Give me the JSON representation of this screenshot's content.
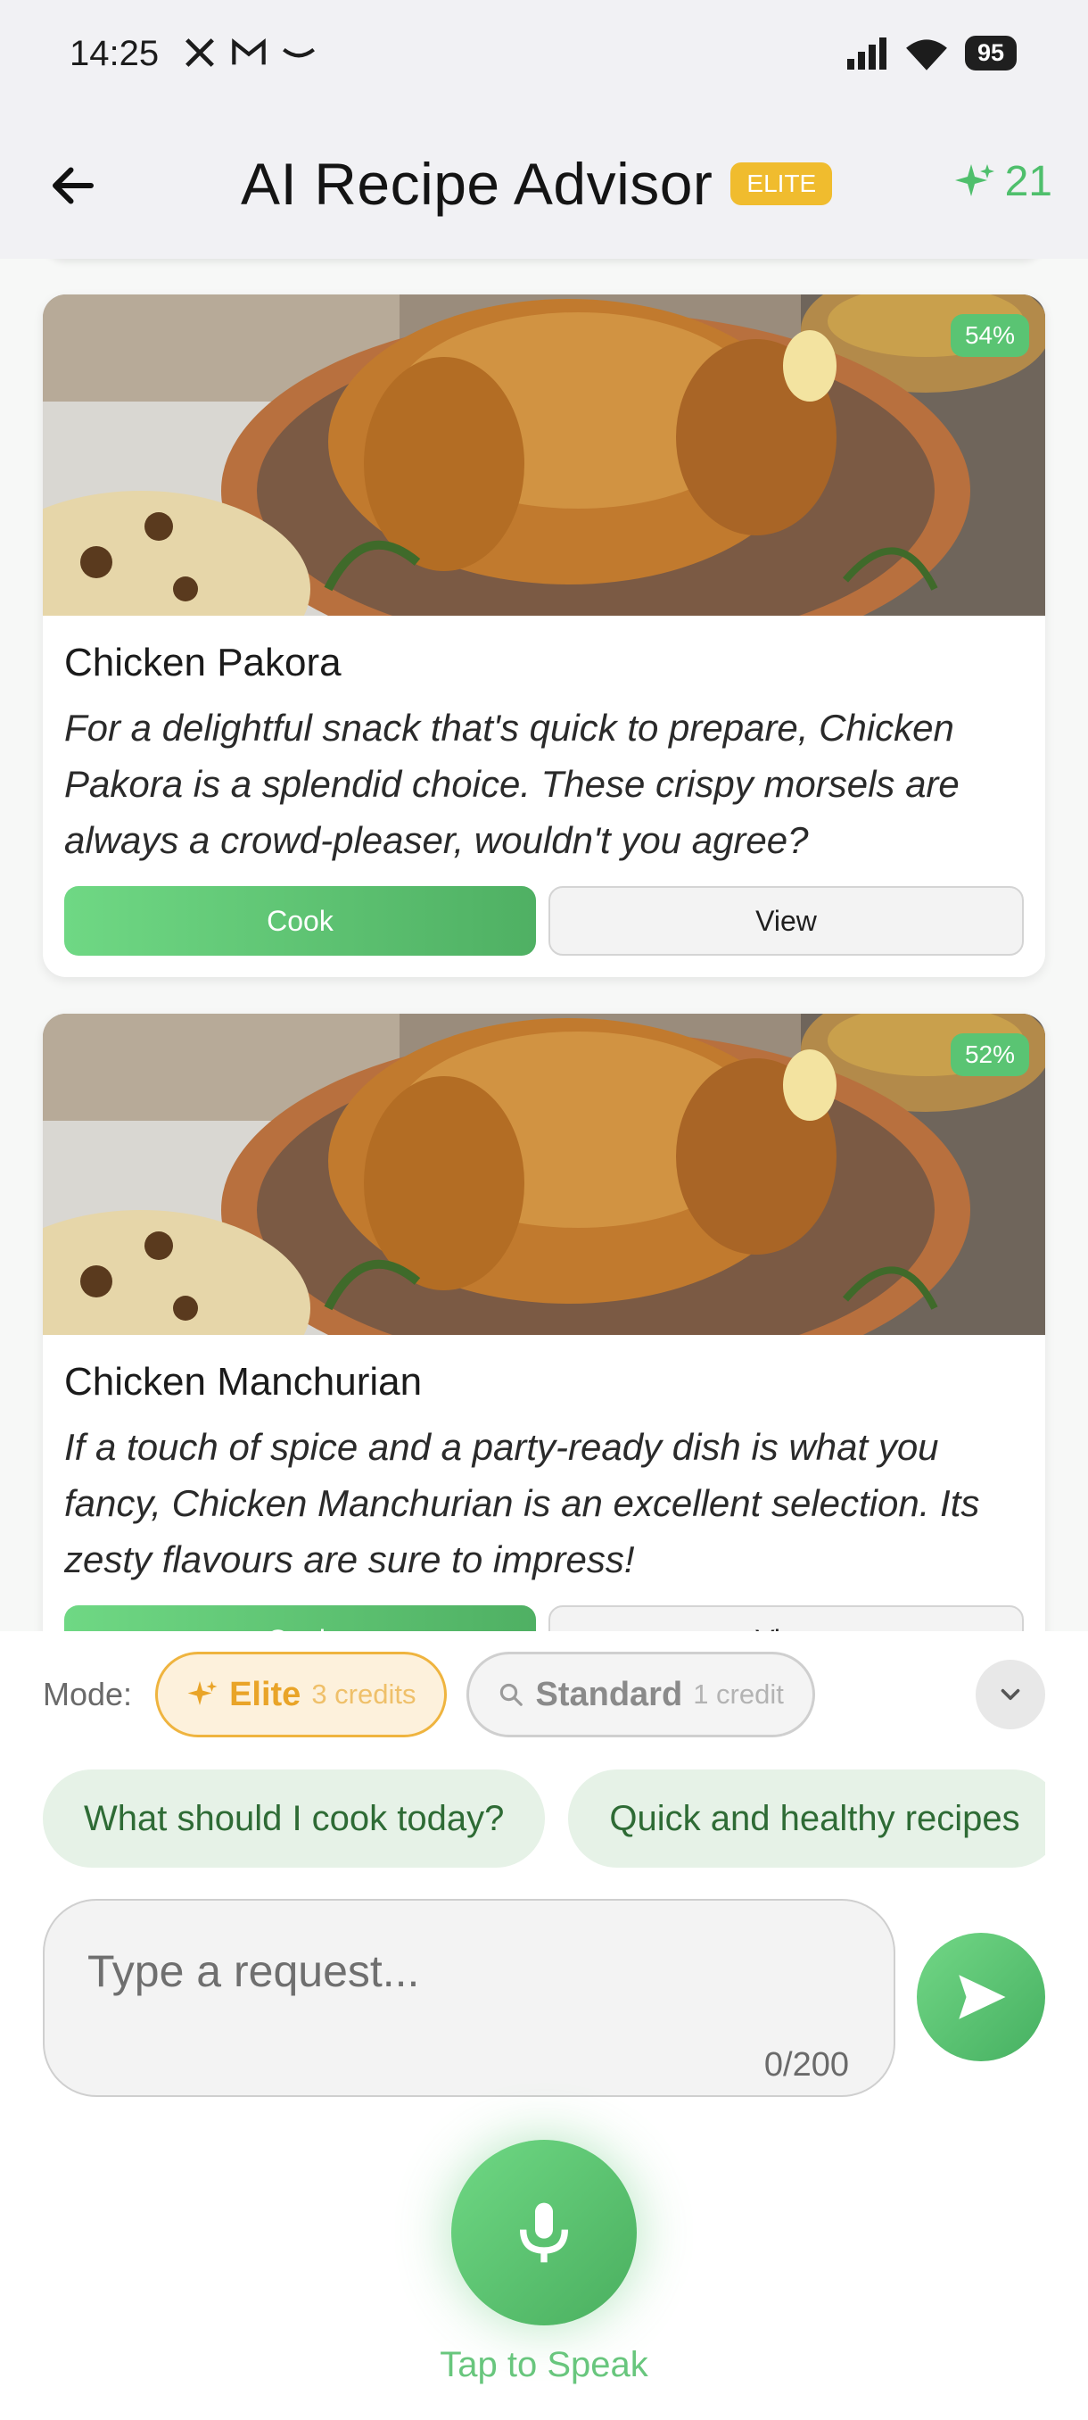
{
  "status_bar": {
    "time": "14:25",
    "battery": "95"
  },
  "header": {
    "title": "AI Recipe Advisor",
    "badge": "ELITE",
    "credits": "21"
  },
  "recipes": [
    {
      "title": "Chicken Pakora",
      "match": "54%",
      "description": "For a delightful snack that's quick to prepare, Chicken Pakora is a splendid choice. These crispy morsels are always a crowd-pleaser, wouldn't you agree?",
      "cook_label": "Cook",
      "view_label": "View"
    },
    {
      "title": "Chicken Manchurian",
      "match": "52%",
      "description": "If a touch of spice and a party-ready dish is what you fancy, Chicken Manchurian is an excellent selection. Its zesty flavours are sure to impress!",
      "cook_label": "Cook",
      "view_label": "View"
    }
  ],
  "mode": {
    "label": "Mode:",
    "elite": {
      "name": "Elite",
      "cost": "3 credits"
    },
    "standard": {
      "name": "Standard",
      "cost": "1 credit"
    }
  },
  "suggestions": [
    "What should I cook today?",
    "Quick and healthy recipes"
  ],
  "input": {
    "placeholder": "Type a request...",
    "counter": "0/200"
  },
  "voice": {
    "label": "Tap to Speak"
  },
  "colors": {
    "accent_green": "#5ac473",
    "elite_gold": "#efb43f",
    "header_bg": "#f1f1f4"
  }
}
